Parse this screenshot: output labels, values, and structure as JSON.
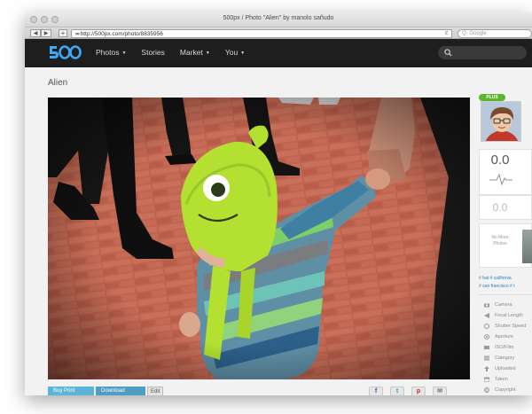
{
  "window": {
    "title": "500px / Photo \"Alien\" by manolo sañudo"
  },
  "toolbar": {
    "back": "◀",
    "forward": "▶",
    "plus": "+",
    "url_prefix": "∞",
    "url": "http://500px.com/photo/8835956",
    "reload": "ℭ",
    "search_placeholder": "Q- Google"
  },
  "nav": {
    "logo_text": "500",
    "items": [
      {
        "label": "Photos",
        "caret": "▼"
      },
      {
        "label": "Stories",
        "caret": ""
      },
      {
        "label": "Market",
        "caret": "▼"
      },
      {
        "label": "You",
        "caret": "▼"
      }
    ]
  },
  "page": {
    "photo_title": "Alien"
  },
  "actions": {
    "buy": "Buy Print",
    "download": "Download",
    "edit": "Edit",
    "share": [
      {
        "icon": "facebook-icon",
        "glyph": "f",
        "color": "#3b5998"
      },
      {
        "icon": "twitter-icon",
        "glyph": "t",
        "color": "#1da1f2"
      },
      {
        "icon": "pinterest-icon",
        "glyph": "p",
        "color": "#cb2027"
      },
      {
        "icon": "mail-icon",
        "glyph": "✉",
        "color": "#777777"
      }
    ]
  },
  "sidebar": {
    "badge": "PLUS",
    "pulse": "0.0",
    "pulse_secondary": "0.0",
    "no_more": "No More Photos",
    "tags": [
      "# hat",
      "# california",
      "# san francisco",
      "# t"
    ],
    "meta": [
      {
        "icon": "camera-icon",
        "label": "Camera"
      },
      {
        "icon": "focal-length-icon",
        "label": "Focal Length"
      },
      {
        "icon": "shutter-speed-icon",
        "label": "Shutter Speed"
      },
      {
        "icon": "aperture-icon",
        "label": "Aperture"
      },
      {
        "icon": "iso-icon",
        "label": "ISO/Film"
      },
      {
        "icon": "category-icon",
        "label": "Category"
      },
      {
        "icon": "upload-icon",
        "label": "Uploaded"
      },
      {
        "icon": "calendar-icon",
        "label": "Taken"
      },
      {
        "icon": "copyright-icon",
        "label": "Copyright"
      }
    ]
  },
  "colors": {
    "nav_bg": "#1e1e1e",
    "logo_blue": "#3fa9f5",
    "link_blue": "#2e7fb8",
    "plus_green": "#5bb531"
  }
}
